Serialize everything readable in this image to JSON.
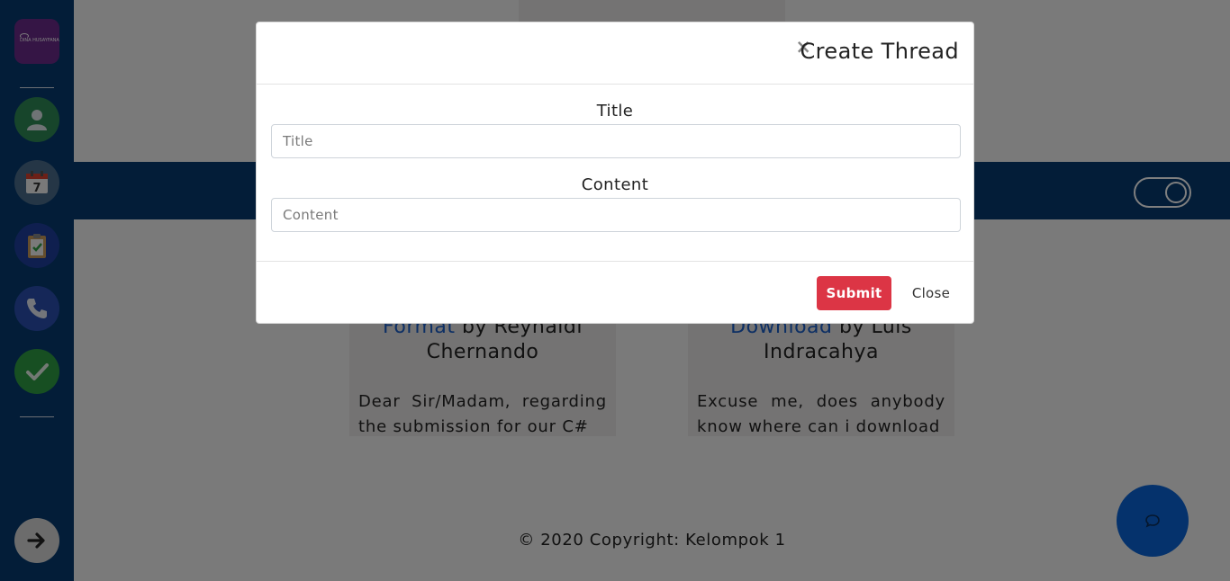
{
  "sidebar": {
    "logo_text": "DINA HUSAYFANA",
    "items": [
      {
        "name": "profile",
        "icon": "user-icon",
        "color": "#2e8b57"
      },
      {
        "name": "calendar",
        "icon": "calendar-icon",
        "color": "#4a6d8c",
        "calendar_day": "7"
      },
      {
        "name": "tasks",
        "icon": "clipboard-icon",
        "color": "#1f3f9e"
      },
      {
        "name": "contact",
        "icon": "phone-icon",
        "color": "#2a4fb0"
      },
      {
        "name": "done",
        "icon": "check-icon",
        "color": "#2f9e44"
      }
    ],
    "logout_icon": "arrow-right-icon"
  },
  "cards": [
    {
      "link": "Format",
      "by": " by Reynaldi",
      "author_line2": "Chernando",
      "body": "Dear Sir/Madam, regarding the submission for our C#"
    },
    {
      "link": "Download",
      "by": " by Luis",
      "author_line2": "Indracahya",
      "body": "Excuse me, does anybody know where can i download"
    }
  ],
  "footer": {
    "text": "© 2020 Copyright: Kelompok 1"
  },
  "modal": {
    "close_symbol": "×",
    "title": "Create Thread",
    "title_label": "Title",
    "title_placeholder": "Title",
    "content_label": "Content",
    "content_placeholder": "Content",
    "submit_label": "Submit",
    "close_label": "Close"
  },
  "colors": {
    "sidebar": "#063a70",
    "banner": "#063a70",
    "submit": "#dc3545",
    "link": "#1a5ec9",
    "chat_fab": "#0b65d8"
  }
}
